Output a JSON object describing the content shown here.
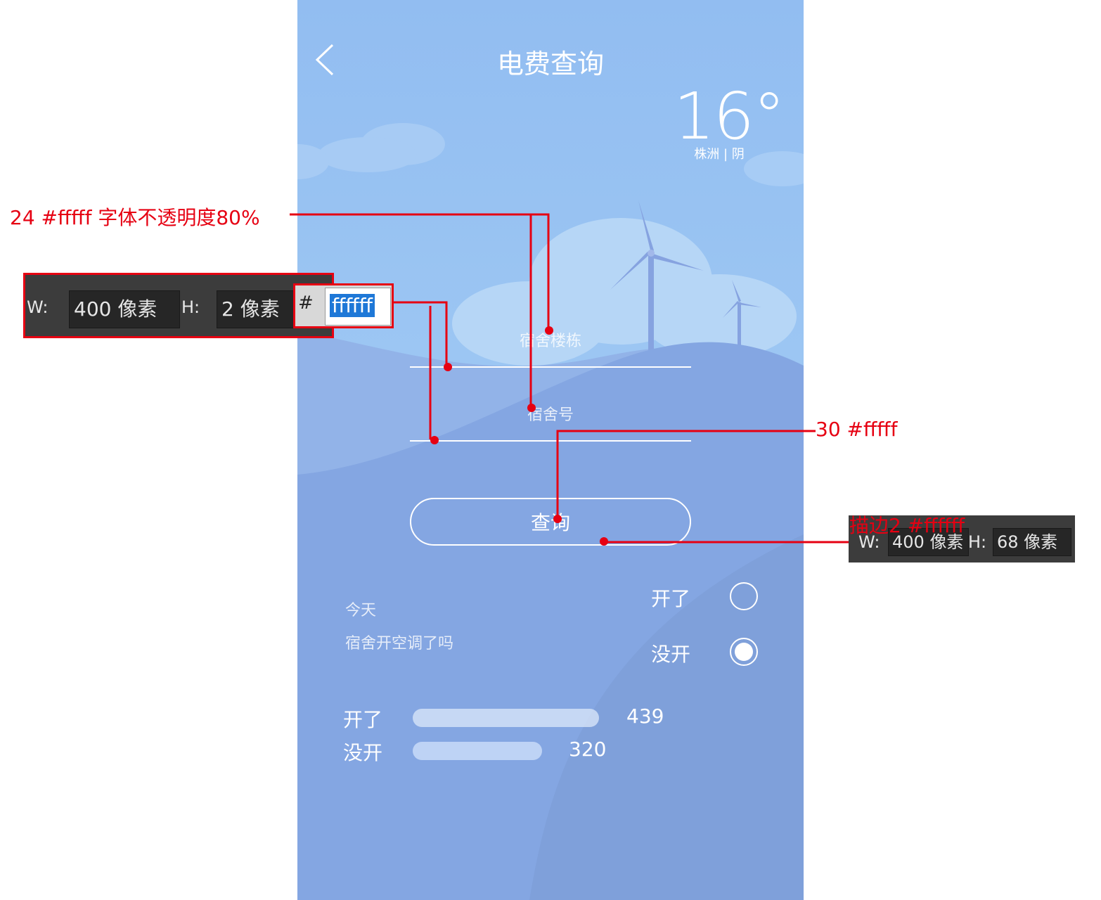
{
  "header": {
    "title": "电费查询",
    "back_icon": "chevron-left-icon"
  },
  "weather": {
    "temperature": "16°",
    "location": "株洲 | 阴"
  },
  "form": {
    "building_placeholder": "宿舍楼栋",
    "room_placeholder": "宿舍号",
    "query_label": "查询"
  },
  "poll": {
    "line1": "今天",
    "line2": "宿舍开空调了吗",
    "options": [
      {
        "label": "开了",
        "selected": false
      },
      {
        "label": "没开",
        "selected": true
      }
    ]
  },
  "stats": [
    {
      "label": "开了",
      "value": "439"
    },
    {
      "label": "没开",
      "value": "320"
    }
  ],
  "annotations": {
    "placeholder_spec": "24 #fffff 字体不透明度80%",
    "button_text_spec": "30 #fffff",
    "button_border_spec": "描边2 #ffffff",
    "line_panel": {
      "w_label": "W:",
      "w_value": "400 像素",
      "h_label": "H:",
      "h_value": "2 像素",
      "hash": "#",
      "color": "ffffff"
    },
    "button_panel": {
      "w_label": "W:",
      "w_value": "400 像素",
      "h_label": "H:",
      "h_value": "68 像素"
    }
  },
  "colors": {
    "annotation_red": "#e60012",
    "sky": "#92bdf1",
    "hill": "#7fa0da"
  }
}
